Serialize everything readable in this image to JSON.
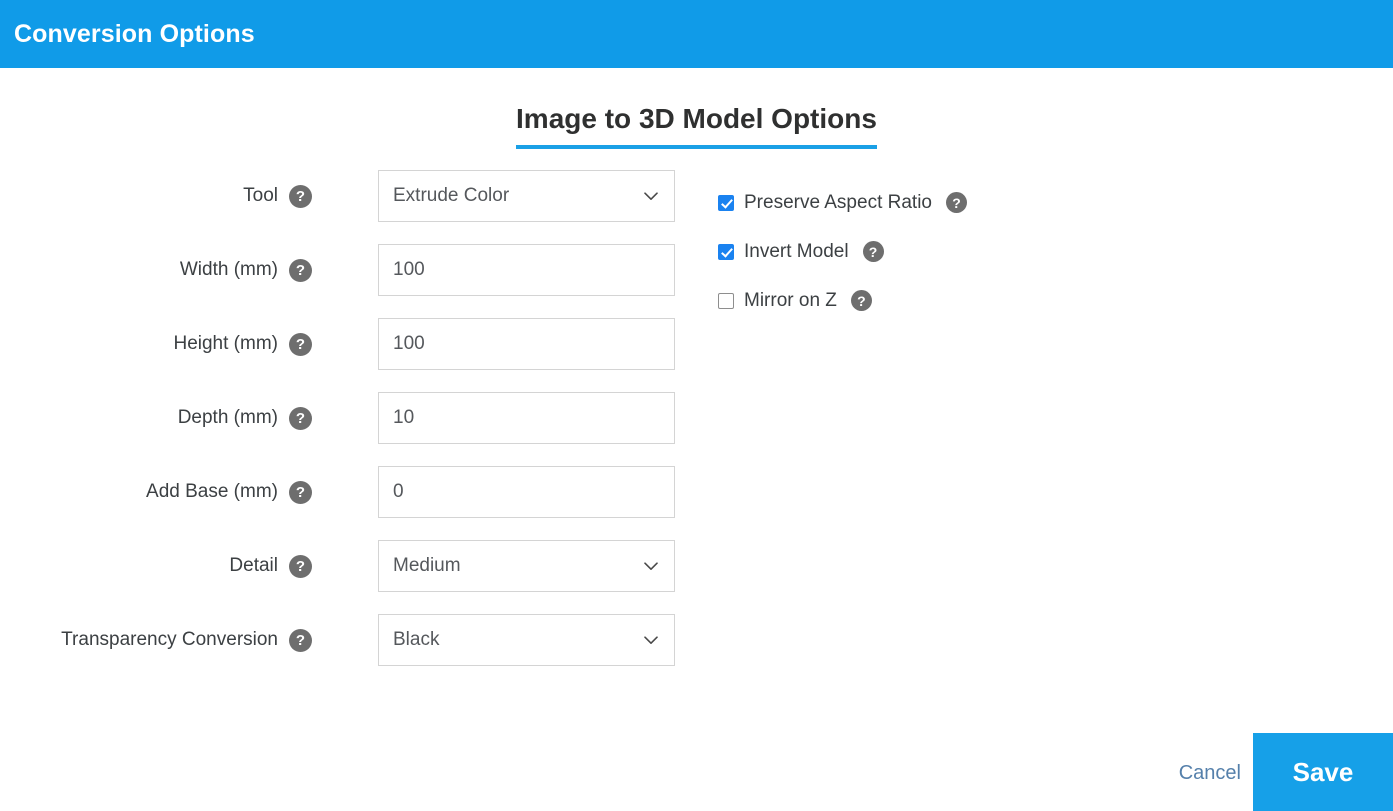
{
  "window": {
    "title": "Conversion Options",
    "header_color": "#109BE8"
  },
  "heading": {
    "text": "Image to 3D Model Options",
    "underline_color": "#1AA0E6"
  },
  "help_icon_glyph": "?",
  "fields": [
    {
      "label": "Tool",
      "help": "?",
      "control": "select",
      "value": "Extrude Color"
    },
    {
      "label": "Width (mm)",
      "help": "?",
      "control": "input",
      "value": "100"
    },
    {
      "label": "Height (mm)",
      "help": "?",
      "control": "input",
      "value": "100"
    },
    {
      "label": "Depth (mm)",
      "help": "?",
      "control": "input",
      "value": "10"
    },
    {
      "label": "Add Base (mm)",
      "help": "?",
      "control": "input",
      "value": "0"
    },
    {
      "label": "Detail",
      "help": "?",
      "control": "select",
      "value": "Medium"
    },
    {
      "label": "Transparency Conversion",
      "help": "?",
      "control": "select",
      "value": "Black"
    }
  ],
  "checkboxes": [
    {
      "label": "Preserve Aspect Ratio",
      "checked": true,
      "help": "?"
    },
    {
      "label": "Invert Model",
      "checked": true,
      "help": "?"
    },
    {
      "label": "Mirror on Z",
      "checked": false,
      "help": "?"
    }
  ],
  "footer": {
    "cancel_label": "Cancel",
    "save_label": "Save",
    "save_color": "#16A0E8",
    "cancel_color": "#5580ab"
  }
}
